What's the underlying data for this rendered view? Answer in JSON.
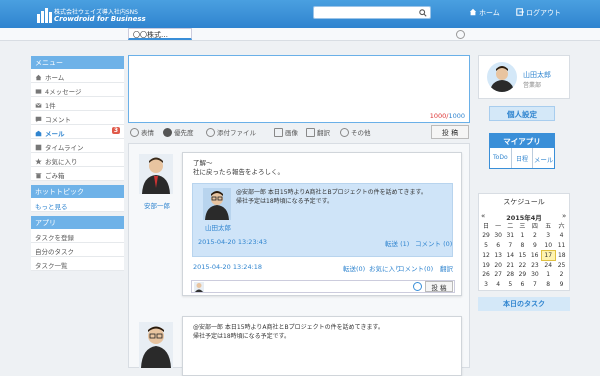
{
  "header": {
    "logo_line1": "株式会社ウェイズ導入社内SNS",
    "logo_line2": "Crowdroid for Business",
    "search_placeholder": "",
    "home": "ホーム",
    "logout": "ログアウト"
  },
  "subbar": {
    "company": "〇〇株式…"
  },
  "sidebar": {
    "menu_title": "メニュー",
    "items": [
      {
        "label": "ホーム",
        "icon": "home-icon"
      },
      {
        "label": "4メッセージ",
        "icon": "message-icon"
      },
      {
        "label": "1件",
        "icon": "envelope-icon"
      },
      {
        "label": "コメント",
        "icon": "comment-icon"
      },
      {
        "label": "メール",
        "icon": "mail-icon",
        "badge": "3"
      },
      {
        "label": "タイムライン",
        "icon": "timeline-icon"
      },
      {
        "label": "お気に入り",
        "icon": "star-icon"
      },
      {
        "label": "ごみ箱",
        "icon": "trash-icon"
      }
    ],
    "hot_title": "ホットトピック",
    "hot_more": "もっと見る",
    "app_title": "アプリ",
    "app_items": [
      "タスクを登録",
      "自分のタスク",
      "タスク一覧"
    ]
  },
  "composer": {
    "count": "1000",
    "max": "1000",
    "post_label": "投 稿"
  },
  "tools": [
    {
      "label": "表情",
      "color": "#9aa"
    },
    {
      "label": "優先度",
      "color": "#555"
    },
    {
      "label": "添付ファイル",
      "color": "#888"
    },
    {
      "label": "画像",
      "color": "#888"
    },
    {
      "label": "翻訳",
      "color": "#888"
    },
    {
      "label": "その他",
      "color": "#888"
    }
  ],
  "feed": {
    "post1": {
      "author": "安部一郎",
      "text": "了解～\n社に戻ったら報告をよろしく。",
      "quote": {
        "author": "山田太郎",
        "text": "@安部一郎 本日15時よりA商社とBプロジェクトの件を話めてきます。\n帰社予定は18時頃になる予定です。",
        "time": "2015-04-20 13:23:43",
        "forward": "転送 (1)",
        "comment": "コメント (0)"
      },
      "time": "2015-04-20 13:24:18",
      "forward": "転送(0)",
      "favorite": "お気に入り",
      "comment": "コメント(0)",
      "translate": "翻訳",
      "reply_post": "投 稿"
    },
    "post2": {
      "text": "@安部一郎 本日15時よりA商社とBプロジェクトの件を話めてきます。\n帰社予定は18時頃になる予定です。"
    }
  },
  "profile": {
    "name": "山田太郎",
    "dept": "営業部"
  },
  "buttons": {
    "personal": "個人設定",
    "myapp": "マイアプリ"
  },
  "myapp_cells": [
    "ToDo",
    "日程",
    "メール"
  ],
  "calendar": {
    "title": "スケジュール",
    "month": "2015年4月",
    "prev": "«",
    "next": "»",
    "weekdays": [
      "日",
      "一",
      "二",
      "三",
      "四",
      "五",
      "六"
    ],
    "weeks": [
      [
        "29",
        "30",
        "31",
        "1",
        "2",
        "3",
        "4"
      ],
      [
        "5",
        "6",
        "7",
        "8",
        "9",
        "10",
        "11"
      ],
      [
        "12",
        "13",
        "14",
        "15",
        "16",
        "17",
        "18"
      ],
      [
        "19",
        "20",
        "21",
        "22",
        "23",
        "24",
        "25"
      ],
      [
        "26",
        "27",
        "28",
        "29",
        "30",
        "1",
        "2"
      ],
      [
        "3",
        "4",
        "5",
        "6",
        "7",
        "8",
        "9"
      ]
    ],
    "selected": "17"
  },
  "today_tasks": "本日のタスク"
}
